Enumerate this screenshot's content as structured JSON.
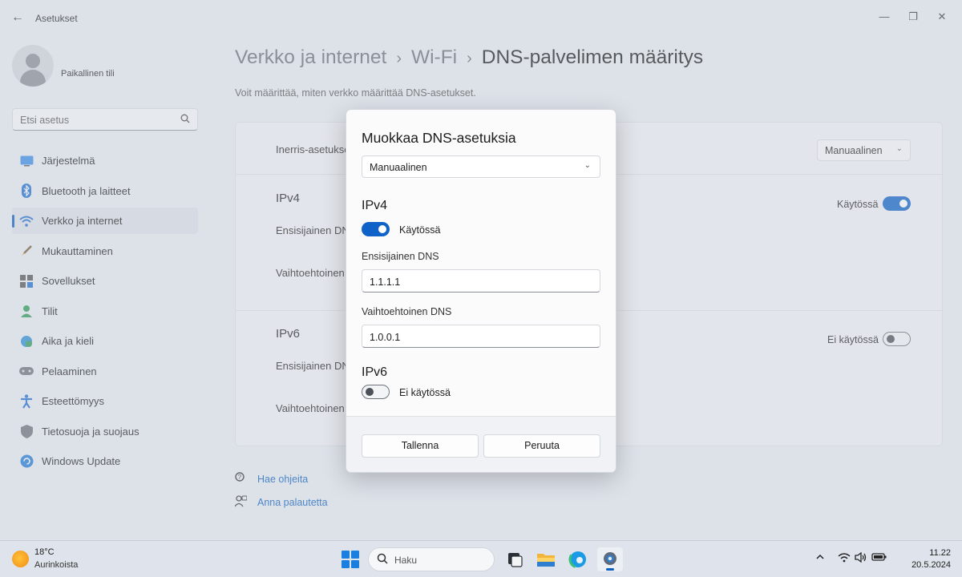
{
  "window": {
    "app_title": "Asetukset",
    "minimize": "—",
    "maximize": "❐",
    "close": "✕",
    "back": "←"
  },
  "account": {
    "name": "Paikallinen tili"
  },
  "search": {
    "placeholder": "Etsi asetus",
    "icon": "🔍"
  },
  "sidebar": {
    "items": [
      {
        "label": "Järjestelmä",
        "icon": "monitor-icon"
      },
      {
        "label": "Bluetooth ja laitteet",
        "icon": "bluetooth-icon"
      },
      {
        "label": "Verkko ja internet",
        "icon": "wifi-icon",
        "active": true
      },
      {
        "label": "Mukauttaminen",
        "icon": "brush-icon"
      },
      {
        "label": "Sovellukset",
        "icon": "apps-icon"
      },
      {
        "label": "Tilit",
        "icon": "person-icon"
      },
      {
        "label": "Aika ja kieli",
        "icon": "globe-clock-icon"
      },
      {
        "label": "Pelaaminen",
        "icon": "gamepad-icon"
      },
      {
        "label": "Esteettömyys",
        "icon": "accessibility-icon"
      },
      {
        "label": "Tietosuoja ja suojaus",
        "icon": "shield-icon"
      },
      {
        "label": "Windows Update",
        "icon": "update-icon"
      }
    ]
  },
  "breadcrumb": {
    "level1": "Verkko ja internet",
    "sep": "›",
    "level2": "Wi-Fi",
    "current": "DNS-palvelimen määritys"
  },
  "subtitle": "Voit määrittää, miten verkko määrittää DNS-asetukset.",
  "card": {
    "assignment_label": "Inerris-asetukset",
    "assignment_value": "Manuaalinen",
    "ipv4": {
      "heading": "IPv4",
      "state": "Käytössä",
      "preferred": "Ensisijainen DNS",
      "alternate": "Vaihtoehtoinen DNS",
      "enabled": true
    },
    "ipv6": {
      "heading": "IPv6",
      "state": "Ei käytössä",
      "preferred": "Ensisijainen DNS",
      "alternate": "Vaihtoehtoinen DNS",
      "enabled": false
    }
  },
  "help": {
    "get_help": "Hae ohjeita",
    "feedback": "Anna palautetta"
  },
  "dialog": {
    "title": "Muokkaa DNS-asetuksia",
    "mode": "Manuaalinen",
    "ipv4_heading": "IPv4",
    "ipv4_state": "Käytössä",
    "ipv4_enabled": true,
    "preferred_label": "Ensisijainen DNS",
    "preferred_value": "1.1.1.1",
    "alternate_label": "Vaihtoehtoinen DNS",
    "alternate_value": "1.0.0.1",
    "ipv6_heading": "IPv6",
    "ipv6_state": "Ei käytössä",
    "ipv6_enabled": false,
    "save": "Tallenna",
    "cancel": "Peruuta"
  },
  "taskbar": {
    "weather_temp": "18°C",
    "weather_cond": "Aurinkoista",
    "search_placeholder": "Haku",
    "time": "11.22",
    "date": "20.5.2024"
  },
  "colors": {
    "accent": "#0f62c7",
    "link": "#0a5fbf"
  }
}
